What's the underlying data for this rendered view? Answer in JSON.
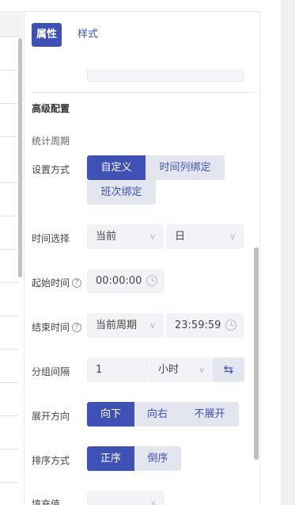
{
  "tabs": [
    {
      "label": "属性",
      "active": true
    },
    {
      "label": "样式",
      "active": false
    }
  ],
  "advanced": {
    "title": "高级配置",
    "stat_period_title": "统计周期",
    "setting_mode": {
      "label": "设置方式",
      "options": [
        "自定义",
        "时间列绑定",
        "班次绑定"
      ],
      "selected": "自定义"
    },
    "time_select": {
      "label": "时间选择",
      "value1": "当前",
      "value2": "日"
    },
    "start_time": {
      "label": "起始时间",
      "value": "00:00:00"
    },
    "end_time": {
      "label": "结束时间",
      "period": "当前周期",
      "value": "23:59:59"
    },
    "group_interval": {
      "label": "分组间隔",
      "value": "1",
      "unit": "小时"
    },
    "expand_direction": {
      "label": "展开方向",
      "options": [
        "向下",
        "向右",
        "不展开"
      ],
      "selected": "向下"
    },
    "sort_mode": {
      "label": "排序方式",
      "options": [
        "正序",
        "倒序"
      ],
      "selected": "正序"
    },
    "fill_value": {
      "label": "填充值"
    }
  },
  "icons": {
    "chevron": "chevron-down-icon",
    "clock": "clock-icon",
    "swap": "swap-icon",
    "help": "help-circle-icon"
  },
  "colors": {
    "accent": "#3f51b5",
    "option_bg": "#e3e6ee",
    "field_bg": "#f2f3f6"
  }
}
